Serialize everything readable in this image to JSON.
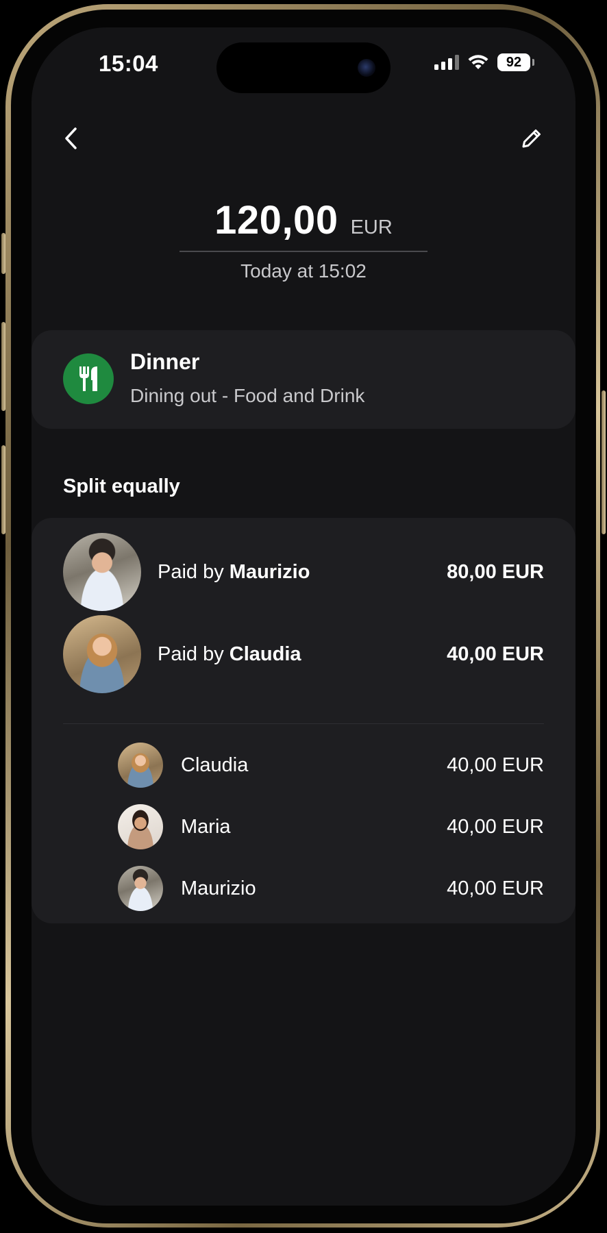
{
  "status_bar": {
    "time": "15:04",
    "battery": "92"
  },
  "nav": {
    "back_icon": "chevron-left-icon",
    "edit_icon": "pencil-icon"
  },
  "expense": {
    "amount": "120,00",
    "currency": "EUR",
    "date": "Today at 15:02"
  },
  "category": {
    "icon": "fork-knife-icon",
    "icon_color": "#1f8a3f",
    "title": "Dinner",
    "subtitle": "Dining out - Food and Drink"
  },
  "split": {
    "title": "Split equally",
    "payers": [
      {
        "prefix": "Paid by ",
        "name": "Maurizio",
        "amount": "80,00 EUR"
      },
      {
        "prefix": "Paid by ",
        "name": "Claudia",
        "amount": "40,00 EUR"
      }
    ],
    "members": [
      {
        "name": "Claudia",
        "amount": "40,00 EUR"
      },
      {
        "name": "Maria",
        "amount": "40,00 EUR"
      },
      {
        "name": "Maurizio",
        "amount": "40,00 EUR"
      }
    ]
  }
}
